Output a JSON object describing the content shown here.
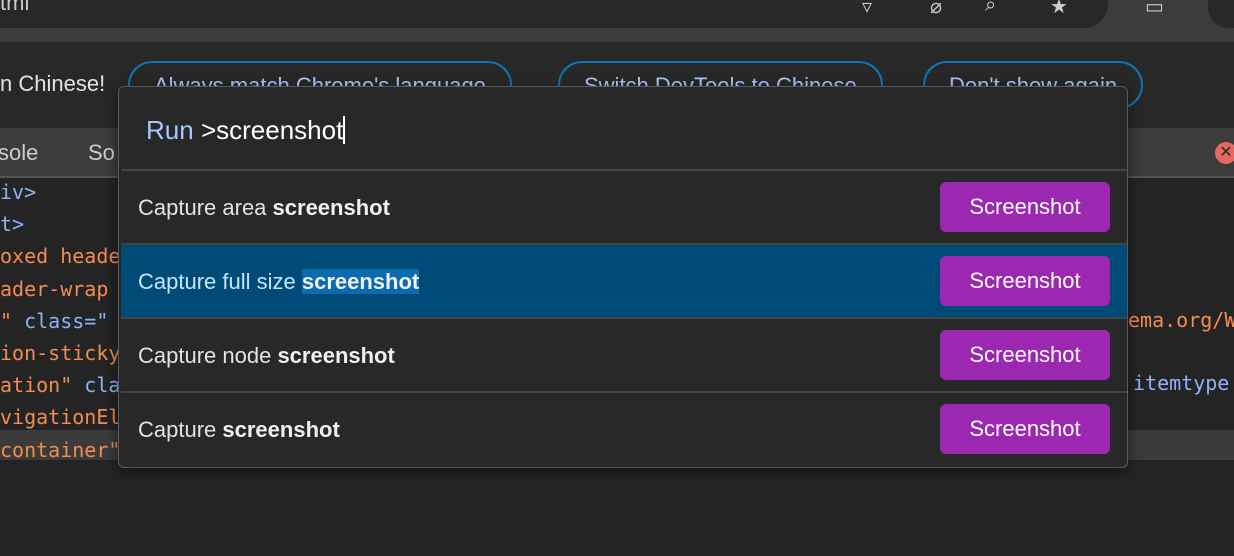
{
  "browser": {
    "title_fragment": "tml",
    "icons": [
      "filter-icon",
      "no-eye-icon",
      "search-icon",
      "star-icon",
      "cast-icon"
    ]
  },
  "infobar": {
    "message": "n Chinese!",
    "buttons": [
      "Always match Chrome's language",
      "Switch DevTools to Chinese",
      "Don't show again"
    ]
  },
  "devtools_tabs": [
    "sole",
    "So"
  ],
  "code_lines": [
    [
      {
        "c": "b",
        "t": "iv>"
      }
    ],
    [
      {
        "c": "b",
        "t": "t>"
      }
    ],
    [
      {
        "c": "o",
        "t": "oxed heade"
      }
    ],
    [
      {
        "c": "o",
        "t": "ader-wrap"
      }
    ],
    [
      {
        "c": "o",
        "t": "\" "
      },
      {
        "c": "b",
        "t": "class=\""
      }
    ],
    [
      {
        "c": "o",
        "t": "ion-sticky"
      }
    ],
    [
      {
        "c": "o",
        "t": "ation\" "
      },
      {
        "c": "b",
        "t": "cla"
      }
    ],
    [
      {
        "c": "o",
        "t": "vigationEl"
      }
    ],
    [
      {
        "c": "o",
        "t": "container\""
      }
    ]
  ],
  "code_right": [
    "ema.org/W",
    "itemtype"
  ],
  "command_menu": {
    "prefix": "Run",
    "query": ">screenshot",
    "items": [
      {
        "pre": "Capture area ",
        "bold": "screenshot",
        "badge": "Screenshot",
        "selected": false
      },
      {
        "pre": "Capture full size ",
        "bold": "screenshot",
        "badge": "Screenshot",
        "selected": true
      },
      {
        "pre": "Capture node ",
        "bold": "screenshot",
        "badge": "Screenshot",
        "selected": false
      },
      {
        "pre": "Capture ",
        "bold": "screenshot",
        "badge": "Screenshot",
        "selected": false
      }
    ]
  },
  "colors": {
    "accent_purple": "#9c27b0",
    "selected_row": "#004a77",
    "info_button_border": "#0a78b4"
  }
}
